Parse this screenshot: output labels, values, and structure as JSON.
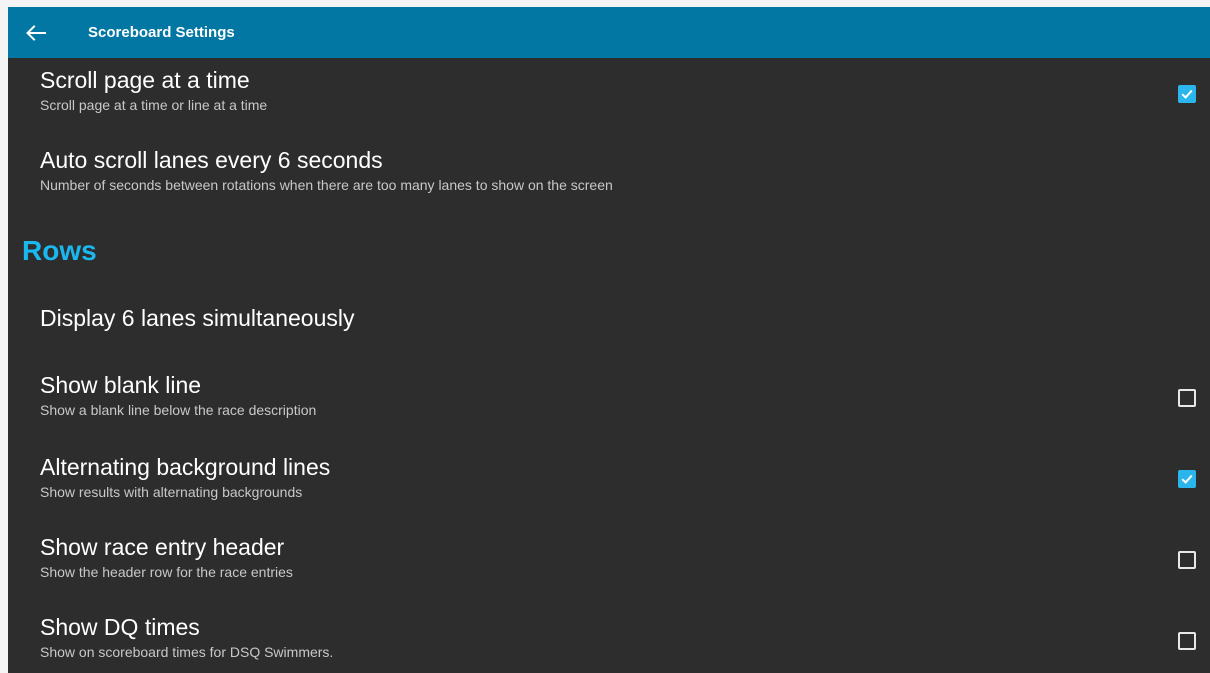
{
  "appbar": {
    "title": "Scoreboard Settings",
    "back_icon": "arrow-left-icon",
    "color": "#0377a3"
  },
  "accent_color": "#1ab8ef",
  "preferences": [
    {
      "title": "Scroll page at a time",
      "summary": "Scroll page at a time or line at a time",
      "checked": true
    },
    {
      "title": "Auto scroll lanes every 6 seconds",
      "summary": "Number of seconds between rotations when there are too many lanes to show on the screen"
    }
  ],
  "rows_category": {
    "label": "Rows",
    "items": [
      {
        "title": "Display 6 lanes simultaneously"
      },
      {
        "title": "Show blank line",
        "summary": "Show a blank line below the race description",
        "checked": false
      },
      {
        "title": "Alternating background lines",
        "summary": "Show results with alternating backgrounds",
        "checked": true
      },
      {
        "title": "Show race entry header",
        "summary": "Show the header row for the race entries",
        "checked": false
      },
      {
        "title": "Show DQ times",
        "summary": "Show on scoreboard times for DSQ Swimmers.",
        "checked": false
      }
    ]
  }
}
